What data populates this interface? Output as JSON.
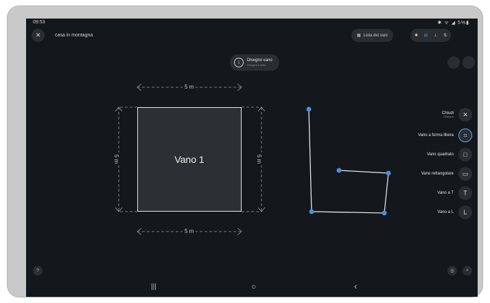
{
  "status_bar": {
    "time": "09:53",
    "indicators": "✱ ᯤ ◢ 5%▮"
  },
  "top_bar": {
    "close_glyph": "✕",
    "project_title": "casa in montagna",
    "room_list_label": "Lista dei vani",
    "room_list_glyph": "▦"
  },
  "hint": {
    "title": "Disegno vano",
    "subtitle": "Disegna il vano",
    "glyph": "i"
  },
  "room": {
    "label": "Vano 1",
    "dim_top": "5 m",
    "dim_bottom": "5 m",
    "dim_left": "5 m",
    "dim_right": "5 m"
  },
  "menu": [
    {
      "label": "Chiudi",
      "sub": "Disegna",
      "glyph": "✕",
      "active": false
    },
    {
      "label": "Vano a forma libera",
      "sub": "",
      "glyph": "⌗",
      "active": true
    },
    {
      "label": "Vano quadrato",
      "sub": "",
      "glyph": "□",
      "active": false
    },
    {
      "label": "Vano rettangolare",
      "sub": "",
      "glyph": "▭",
      "active": false
    },
    {
      "label": "Vano a T",
      "sub": "",
      "glyph": "T",
      "active": false
    },
    {
      "label": "Vano a L",
      "sub": "",
      "glyph": "L",
      "active": false
    }
  ],
  "nav": {
    "recents": "|||",
    "home": "○",
    "back": "‹"
  },
  "colors": {
    "accent": "#5aa7ff",
    "background": "#14171b",
    "surface": "#2a2e33"
  }
}
